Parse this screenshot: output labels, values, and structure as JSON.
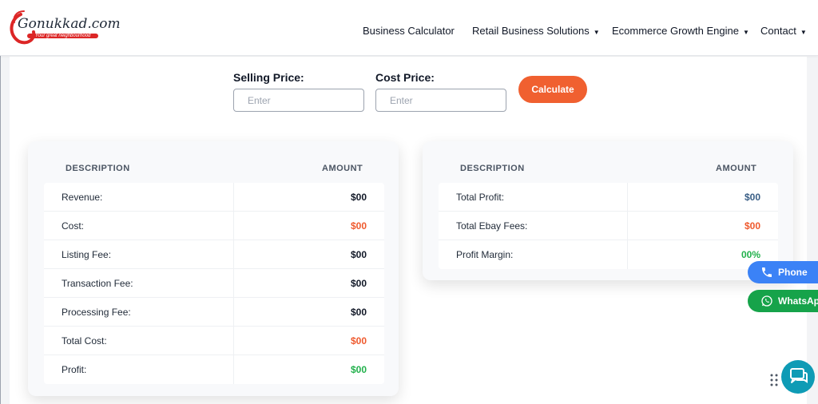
{
  "header": {
    "logo": {
      "name": "Gonukkad.com",
      "tagline": "Your great neighbourhood"
    },
    "nav": [
      {
        "label": "Business Calculator",
        "caret": ""
      },
      {
        "label": "Retail Business Solutions",
        "caret": "▼"
      },
      {
        "label": "Ecommerce Growth Engine",
        "caret": "▼"
      },
      {
        "label": "Contact",
        "caret": "▼"
      }
    ]
  },
  "form": {
    "selling_price": {
      "label": "Selling Price:",
      "placeholder": "Enter",
      "value": ""
    },
    "cost_price": {
      "label": "Cost Price:",
      "placeholder": "Enter",
      "value": ""
    },
    "calculate_label": "Calculate"
  },
  "table_left": {
    "headers": {
      "description": "DESCRIPTION",
      "amount": "AMOUNT"
    },
    "rows": [
      {
        "description": "Revenue:",
        "amount": "$00",
        "color": "#111827"
      },
      {
        "description": "Cost:",
        "amount": "$00",
        "color": "#ef5a2e"
      },
      {
        "description": "Listing Fee:",
        "amount": "$00",
        "color": "#111827"
      },
      {
        "description": "Transaction Fee:",
        "amount": "$00",
        "color": "#111827"
      },
      {
        "description": "Processing Fee:",
        "amount": "$00",
        "color": "#111827"
      },
      {
        "description": "Total Cost:",
        "amount": "$00",
        "color": "#ef5a2e"
      },
      {
        "description": "Profit:",
        "amount": "$00",
        "color": "#22b14c"
      }
    ]
  },
  "table_right": {
    "headers": {
      "description": "DESCRIPTION",
      "amount": "AMOUNT"
    },
    "rows": [
      {
        "description": "Total Profit:",
        "amount": "$00",
        "color": "#3a5f86"
      },
      {
        "description": "Total Ebay Fees:",
        "amount": "$00",
        "color": "#ef5a2e"
      },
      {
        "description": "Profit Margin:",
        "amount": "00%",
        "color": "#22b14c"
      }
    ]
  },
  "floating": {
    "phone_label": "Phone",
    "whatsapp_label": "WhatsApp",
    "phone_color": "#3b82f6",
    "whatsapp_color": "#16a34a",
    "chat_icon": "chat-bubble-icon"
  },
  "colors": {
    "accent": "#f06030"
  }
}
